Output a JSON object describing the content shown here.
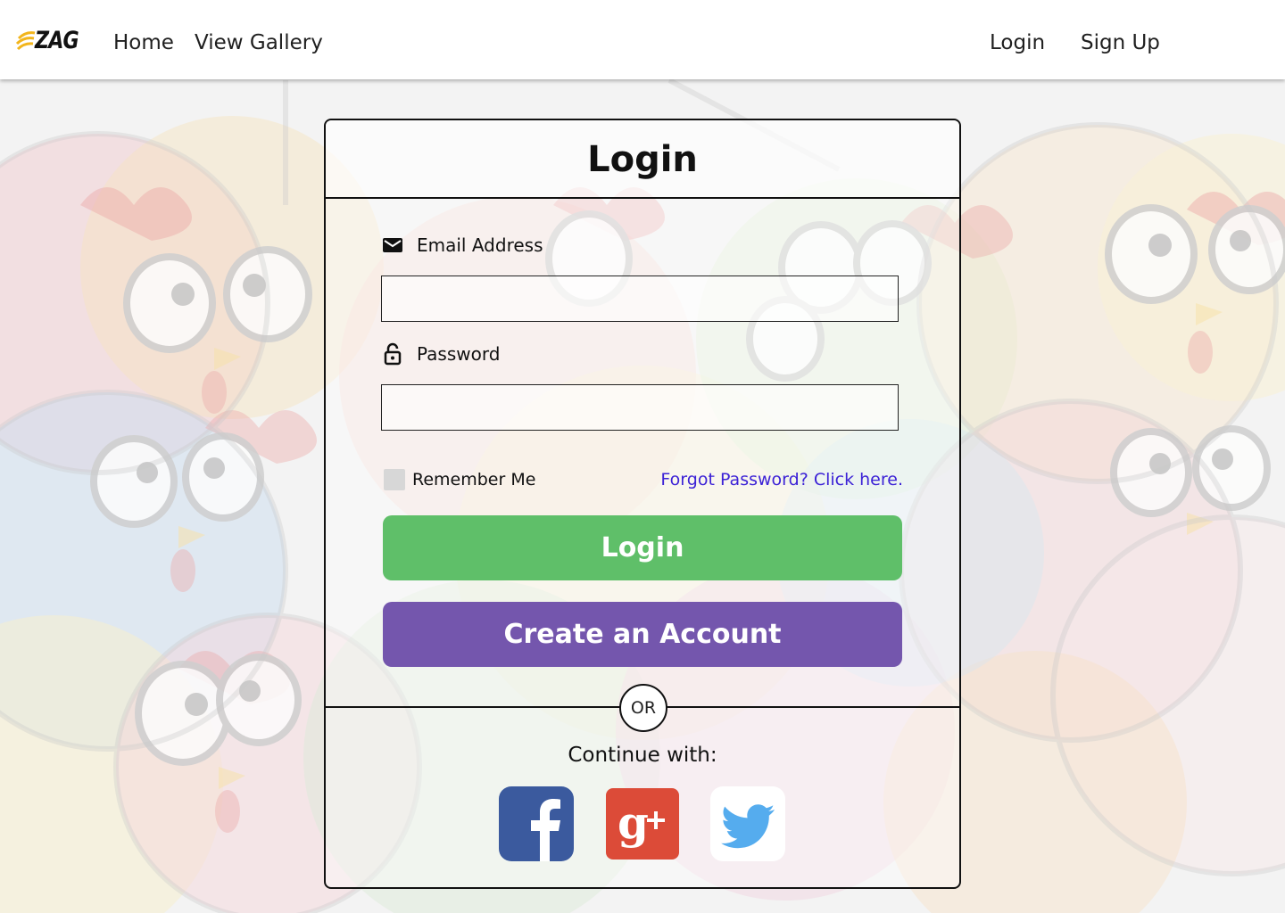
{
  "navbar": {
    "logo_text": "ZAG",
    "links_left": [
      "Home",
      "View Gallery"
    ],
    "links_right": [
      "Login",
      "Sign Up"
    ]
  },
  "card": {
    "title": "Login",
    "email": {
      "label": "Email Address",
      "value": "",
      "placeholder": "",
      "icon": "envelope-icon"
    },
    "password": {
      "label": "Password",
      "value": "",
      "placeholder": "",
      "icon": "lock-icon"
    },
    "remember_label": "Remember Me",
    "remember_checked": false,
    "forgot_link": "Forgot Password? Click here.",
    "login_button": "Login",
    "create_button": "Create an Account",
    "or_text": "OR",
    "continue_text": "Continue with:",
    "social": [
      {
        "name": "facebook",
        "icon": "facebook-icon"
      },
      {
        "name": "google-plus",
        "icon": "google-plus-icon"
      },
      {
        "name": "twitter",
        "icon": "twitter-icon"
      }
    ]
  },
  "colors": {
    "login_button": "#5fbf69",
    "create_button": "#7456ad",
    "forgot_link": "#3c22d6",
    "facebook": "#3b5a9e",
    "google_plus": "#dc4b38",
    "twitter": "#55acee"
  }
}
